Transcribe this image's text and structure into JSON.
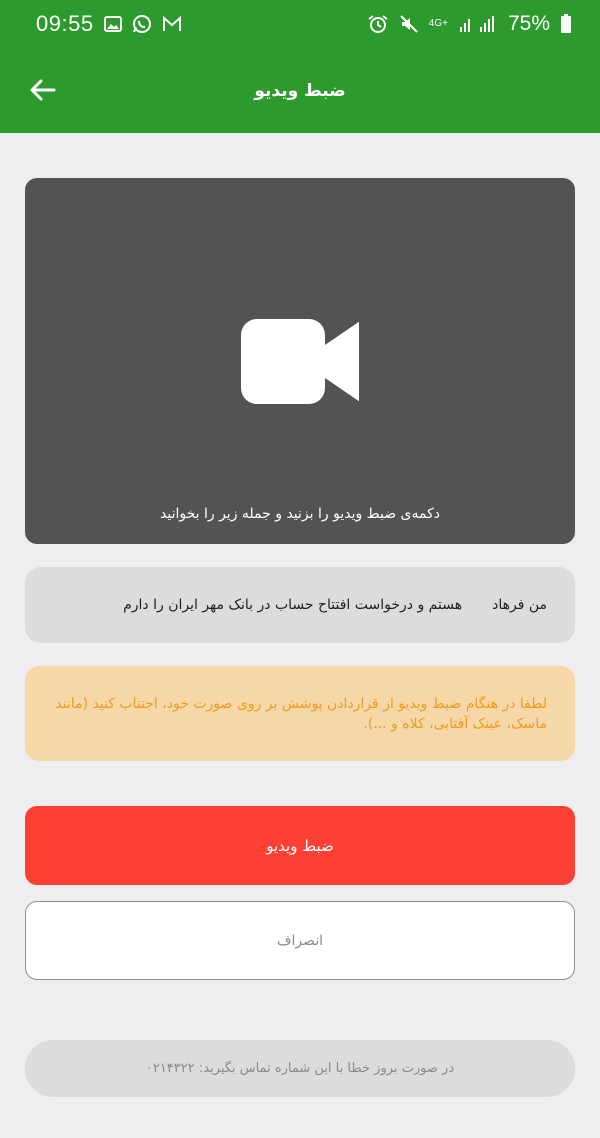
{
  "status_bar": {
    "time": "09:55",
    "network_label": "4G+",
    "battery": "75%",
    "left_icons": [
      "gallery-icon",
      "whatsapp-icon",
      "gmail-icon"
    ],
    "right_icons": [
      "alarm-icon",
      "mute-icon",
      "signal-icon",
      "battery-icon"
    ]
  },
  "app_bar": {
    "title": "ضبط ویدیو",
    "back_icon": "arrow-left-icon",
    "background": "#2d9a2d"
  },
  "video_panel": {
    "icon": "video-camera-icon",
    "instruction": "دکمه‌ی ضبط ویدیو را بزنید و جمله زیر را بخوانید",
    "background": "#535353"
  },
  "sentence": {
    "prefix": "من فرهاد",
    "text": "هستم و درخواست افتتاح حساب در بانک مهر ایران را دارم"
  },
  "warning": {
    "text": "لطفا در هنگام ضبط ویدیو از قراردادن پوشش بر روی صورت خود، اجتناب کنید (مانند ماسک، عینک آفتابی، کلاه و ...).",
    "background": "#f6d8a8",
    "color": "#f09a1f"
  },
  "actions": {
    "record_label": "ضبط ویدیو",
    "record_color": "#fe3f33",
    "cancel_label": "انصراف"
  },
  "support": {
    "text": "در صورت بروز خطا با این شماره تماس بگیرید: ۰۲۱۴۳۲۲"
  }
}
